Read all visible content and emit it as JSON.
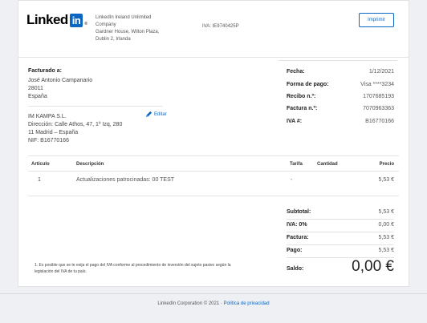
{
  "header": {
    "logo_text": "Linked",
    "logo_in": "in",
    "logo_tm": "®",
    "company_lines": [
      "LinkedIn Ireland Unlimited",
      "Company",
      "Gardner House, Wilton Plaza,",
      "Dublin 2, Irlanda"
    ],
    "vat": "IVA: IE9740425P",
    "print_label": "Imprimir"
  },
  "billing": {
    "title": "Facturado a:",
    "lines": [
      "José Antonio Campanario",
      "28011",
      "España"
    ],
    "company_lines": [
      "IM KAMPA S.L.",
      "Dirección: Calle Athos, 47, 1º Izq, 280",
      "11 Madrid – España",
      "NIF: B16770166"
    ],
    "edit_label": "Editar"
  },
  "invoice_info": [
    {
      "label": "Fecha:",
      "value": "1/12/2021"
    },
    {
      "label": "Forma de pago:",
      "value": "Visa ****3234"
    },
    {
      "label": "Recibo n.º:",
      "value": "1707685193"
    },
    {
      "label": "Factura n.º:",
      "value": "7070963363"
    },
    {
      "label": "IVA #:",
      "value": "B16770166"
    }
  ],
  "table": {
    "headers": {
      "item": "Artículo",
      "description": "Descripción",
      "rate": "Tarifa",
      "quantity": "Cantidad",
      "price": "Precio"
    },
    "rows": [
      {
        "item": "1",
        "description": "Actualizaciones patrocinadas: 00 TEST",
        "rate": "-",
        "quantity": "",
        "price": "5,53 €"
      }
    ]
  },
  "totals": {
    "subtotal_label": "Subtotal:",
    "subtotal_value": "5,53 €",
    "vat_label": "IVA: 0%",
    "vat_value": "0,00 €",
    "invoice_label": "Factura:",
    "invoice_value": "5,53 €",
    "payment_label": "Pago:",
    "payment_value": "5,53 €",
    "balance_label": "Saldo:",
    "balance_value": "0,00 €"
  },
  "note": "1. Es posible que se te exija el pago del IVA conforme al procedimiento de inversión del sujeto pasivo según la legislación del IVA de tu país.",
  "footer": {
    "copyright": "LinkedIn Corporation © 2021 ·",
    "privacy_link": "Política de privacidad"
  },
  "colors": {
    "accent": "#0a66c2",
    "background": "#eef0f3"
  }
}
